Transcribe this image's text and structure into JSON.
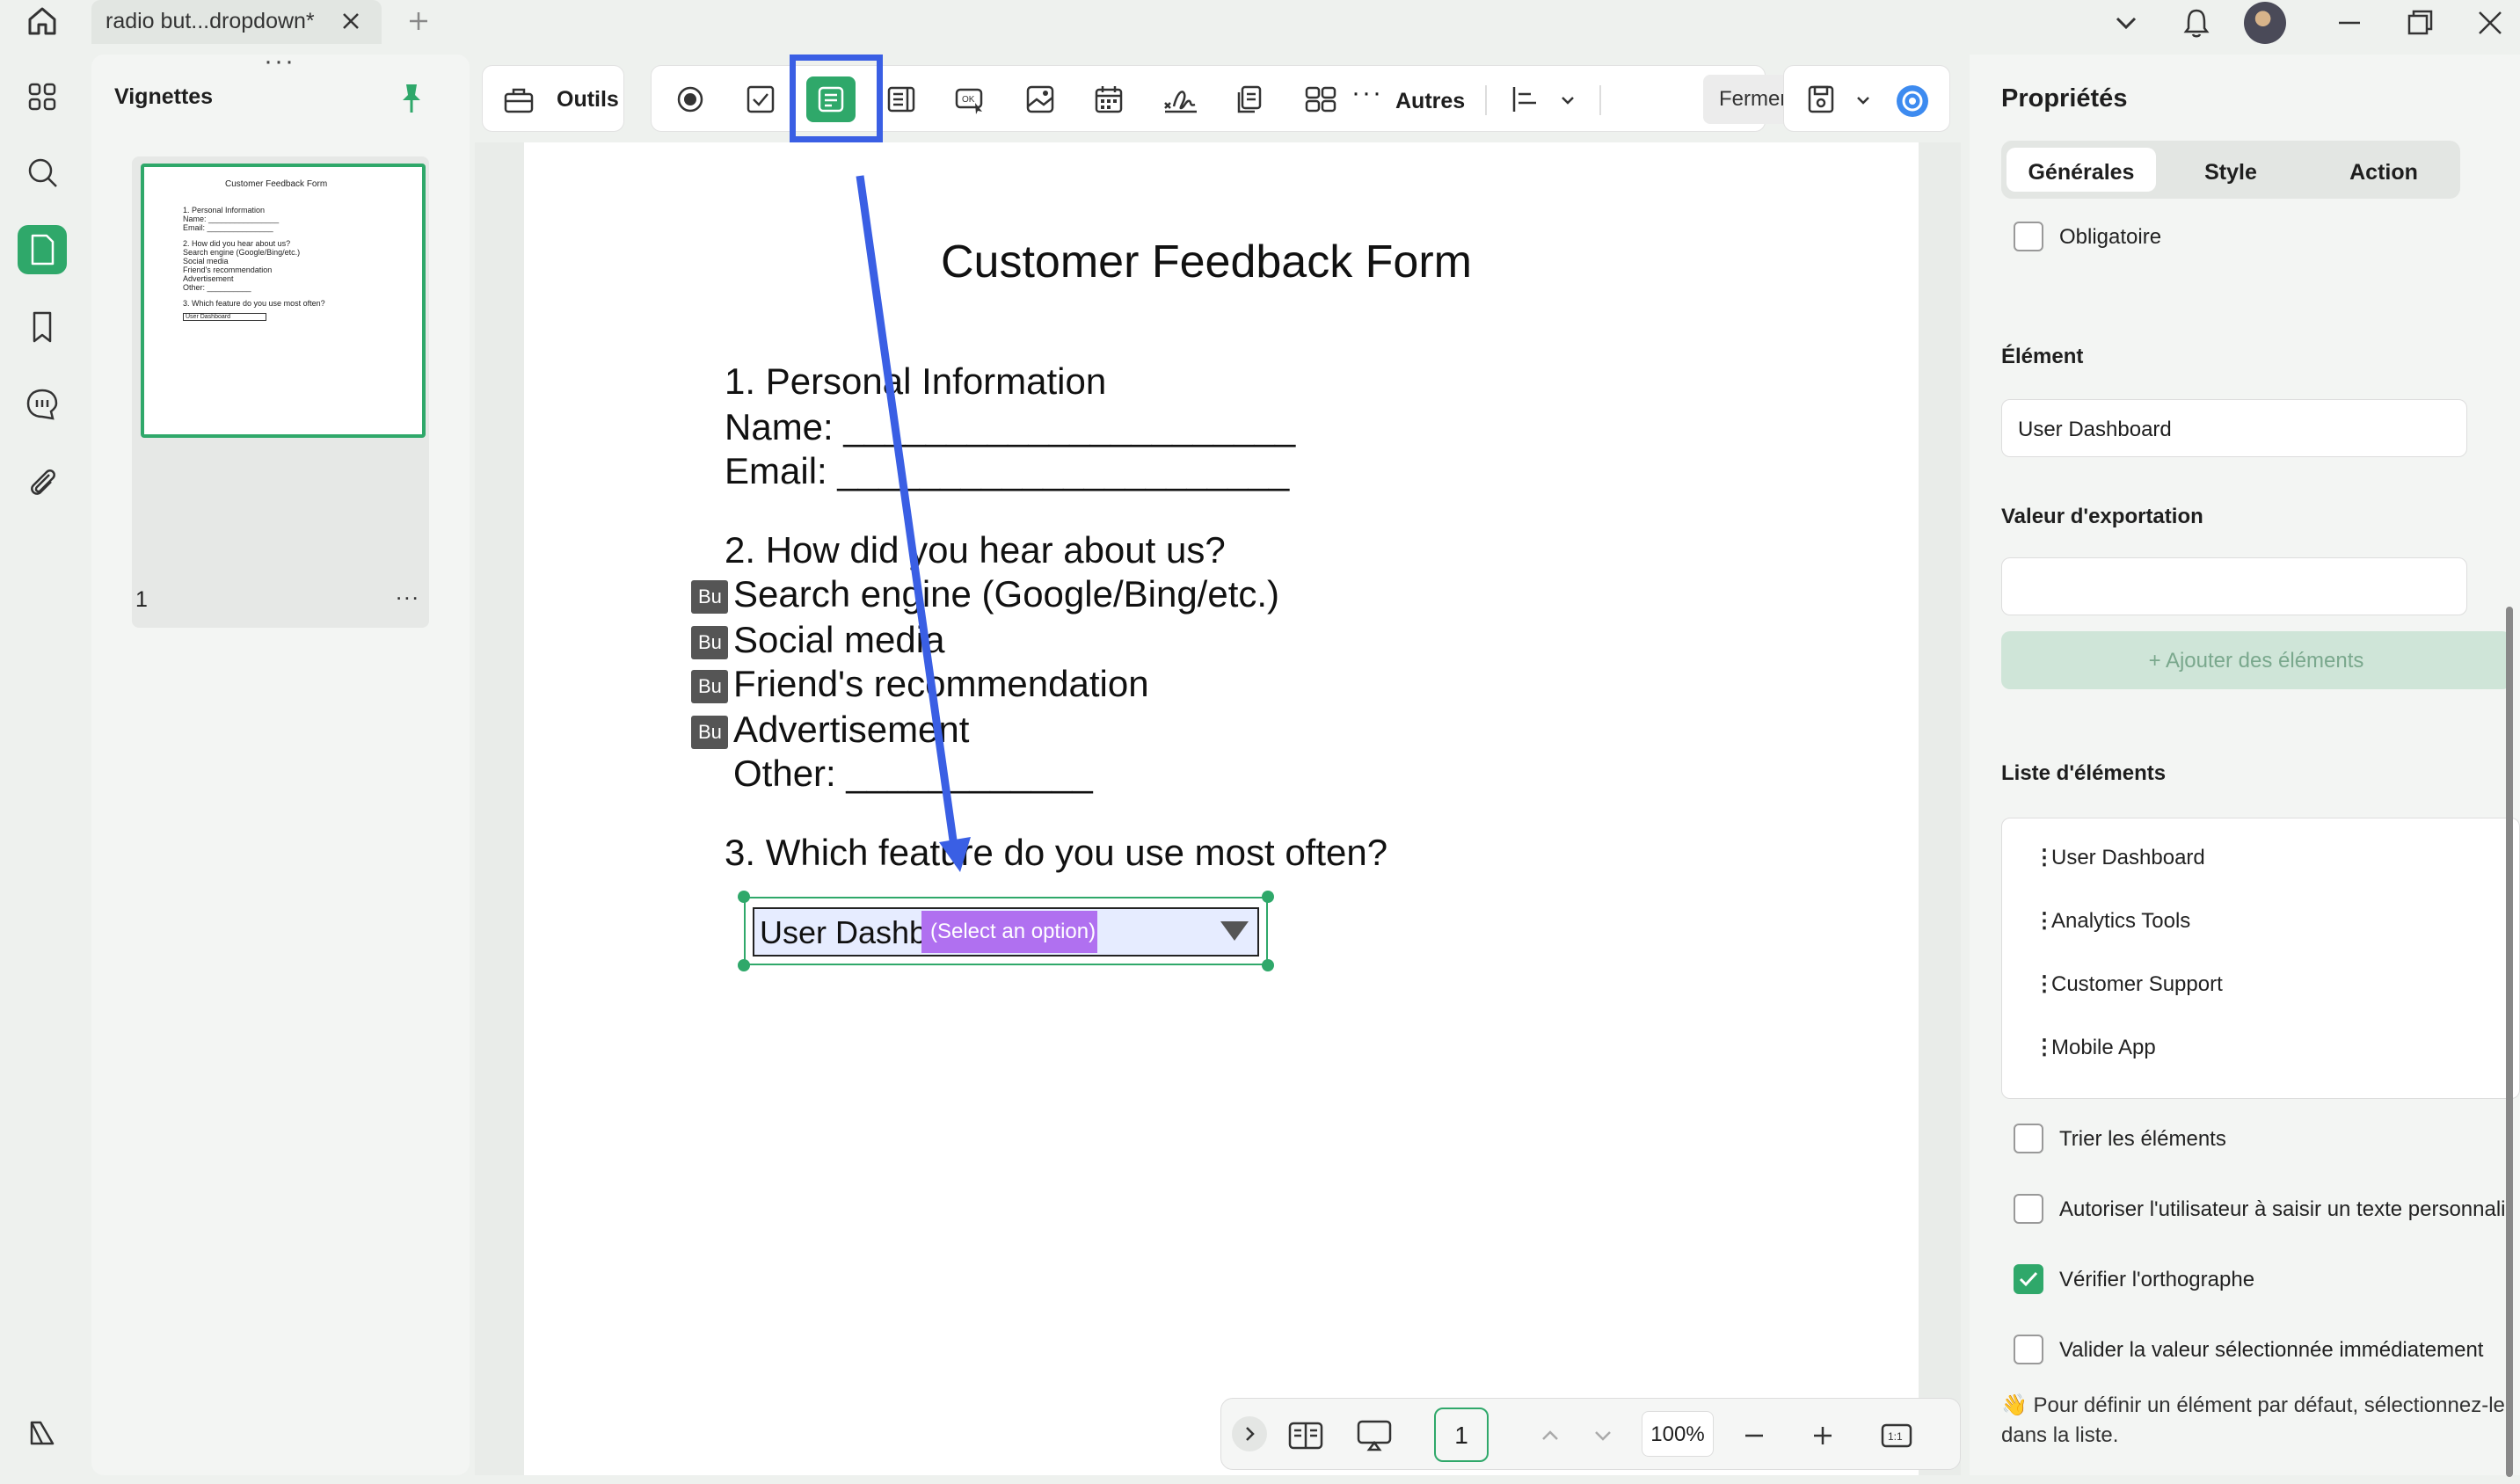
{
  "titlebar": {
    "tab_label": "radio but...dropdown*"
  },
  "thumbnails": {
    "title": "Vignettes",
    "page_number": "1",
    "more": "...",
    "mini_page": {
      "title": "Customer Feedback Form",
      "lines": [
        "1. Personal Information",
        "Name: ________________",
        "Email: _______________",
        "2. How did you hear about us?",
        "Search engine (Google/Bing/etc.)",
        "Social media",
        "Friend's recommendation",
        "Advertisement",
        "Other: __________",
        "3. Which feature do you use most often?",
        "User Dashboard"
      ]
    }
  },
  "toolbar": {
    "outils_label": "Outils",
    "autres_label": "Autres",
    "fermer_label": "Fermer"
  },
  "document": {
    "title": "Customer Feedback Form",
    "section1": "1. Personal Information",
    "name_line": "Name: ______________________",
    "email_line": "Email: ______________________",
    "section2": "2. How did you hear about us?",
    "radio_badge": "Bu",
    "options": [
      "Search engine (Google/Bing/etc.)",
      "Social media",
      "Friend's recommendation",
      "Advertisement"
    ],
    "other_line": "Other: ____________",
    "section3": "3. Which feature do you use most often?",
    "dropdown_value": "User Dashbo",
    "dropdown_placeholder": "(Select an option)"
  },
  "bottom_nav": {
    "page": "1",
    "zoom": "100%"
  },
  "properties": {
    "title": "Propriétés",
    "tabs": [
      "Générales",
      "Style",
      "Action"
    ],
    "required_label": "Obligatoire",
    "element_title": "Élément",
    "element_value": "User Dashboard",
    "export_title": "Valeur d'exportation",
    "export_value": "",
    "add_button": "+ Ajouter des éléments",
    "list_title": "Liste d'éléments",
    "list_items": [
      "User Dashboard",
      "Analytics Tools",
      "Customer Support",
      "Mobile App"
    ],
    "sort_label": "Trier les éléments",
    "custom_text_label": "Autoriser l'utilisateur à saisir un texte personnalisé",
    "spellcheck_label": "Vérifier l'orthographe",
    "commit_label": "Valider la valeur sélectionnée immédiatement",
    "note": "👋 Pour définir un élément par défaut, sélectionnez-le dans la liste.",
    "spellcheck_checked": true
  },
  "colors": {
    "accent": "#2fa86a",
    "highlight": "#3a5fe4",
    "placeholder_bg": "#b070f0"
  }
}
